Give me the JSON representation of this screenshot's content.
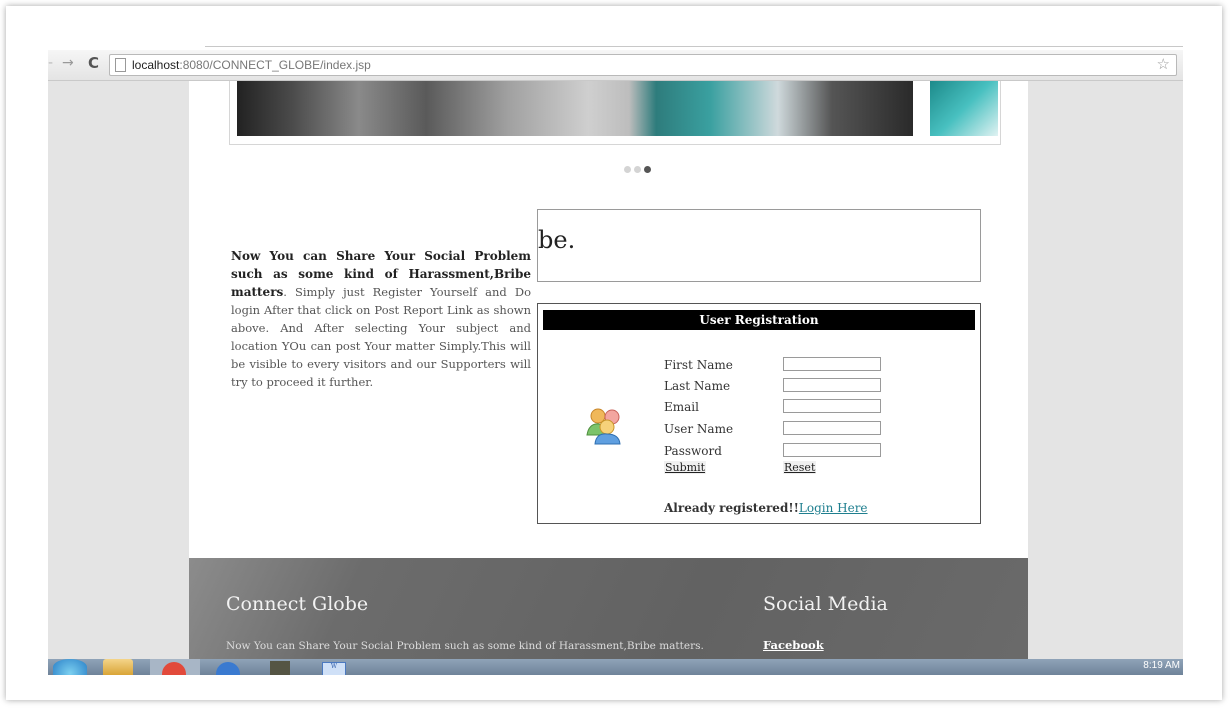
{
  "browser": {
    "url_host": "localhost",
    "url_path": ":8080/CONNECT_GLOBE/index.jsp",
    "back_glyph": "-",
    "forward_glyph": "→",
    "reload_glyph": "C",
    "star_glyph": "☆"
  },
  "slider": {
    "active_dot": 3,
    "dot_count": 3
  },
  "intro": {
    "bold_text": "Now You can Share Your Social Problem such as some kind of Harassment,Bribe matters",
    "bold_suffix": ".",
    "body_text": " Simply just Register Yourself and Do login After that click on Post Report Link as shown above. And After selecting Your subject and location YOu can post Your matter Simply.This will be visible to every visitors and our Supporters will try to proceed it further."
  },
  "marquee": {
    "text": "be."
  },
  "registration": {
    "header": "User Registration",
    "fields": [
      {
        "label": "First Name",
        "value": ""
      },
      {
        "label": "Last Name",
        "value": ""
      },
      {
        "label": "Email",
        "value": ""
      },
      {
        "label": "User Name",
        "value": ""
      },
      {
        "label": "Password",
        "value": ""
      }
    ],
    "submit_label": "Submit",
    "reset_label": "Reset",
    "already_text": "Already registered!!",
    "login_link": "Login Here",
    "icon": "users-icon"
  },
  "footer": {
    "title": "Connect Globe",
    "text": "Now You can Share Your Social Problem such as some kind of Harassment,Bribe matters.",
    "social_title": "Social Media",
    "social_link": "Facebook"
  },
  "taskbar": {
    "clock": "8:19 AM"
  }
}
